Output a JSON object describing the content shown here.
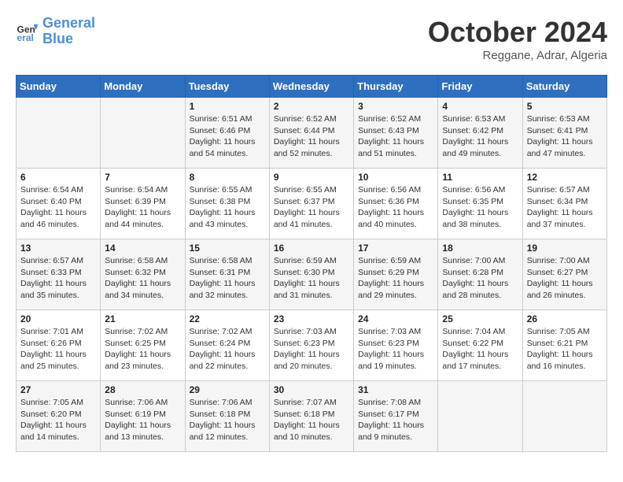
{
  "header": {
    "logo_line1": "General",
    "logo_line2": "Blue",
    "month": "October 2024",
    "location": "Reggane, Adrar, Algeria"
  },
  "weekdays": [
    "Sunday",
    "Monday",
    "Tuesday",
    "Wednesday",
    "Thursday",
    "Friday",
    "Saturday"
  ],
  "weeks": [
    [
      {
        "day": "",
        "sunrise": "",
        "sunset": "",
        "daylight": ""
      },
      {
        "day": "",
        "sunrise": "",
        "sunset": "",
        "daylight": ""
      },
      {
        "day": "1",
        "sunrise": "Sunrise: 6:51 AM",
        "sunset": "Sunset: 6:46 PM",
        "daylight": "Daylight: 11 hours and 54 minutes."
      },
      {
        "day": "2",
        "sunrise": "Sunrise: 6:52 AM",
        "sunset": "Sunset: 6:44 PM",
        "daylight": "Daylight: 11 hours and 52 minutes."
      },
      {
        "day": "3",
        "sunrise": "Sunrise: 6:52 AM",
        "sunset": "Sunset: 6:43 PM",
        "daylight": "Daylight: 11 hours and 51 minutes."
      },
      {
        "day": "4",
        "sunrise": "Sunrise: 6:53 AM",
        "sunset": "Sunset: 6:42 PM",
        "daylight": "Daylight: 11 hours and 49 minutes."
      },
      {
        "day": "5",
        "sunrise": "Sunrise: 6:53 AM",
        "sunset": "Sunset: 6:41 PM",
        "daylight": "Daylight: 11 hours and 47 minutes."
      }
    ],
    [
      {
        "day": "6",
        "sunrise": "Sunrise: 6:54 AM",
        "sunset": "Sunset: 6:40 PM",
        "daylight": "Daylight: 11 hours and 46 minutes."
      },
      {
        "day": "7",
        "sunrise": "Sunrise: 6:54 AM",
        "sunset": "Sunset: 6:39 PM",
        "daylight": "Daylight: 11 hours and 44 minutes."
      },
      {
        "day": "8",
        "sunrise": "Sunrise: 6:55 AM",
        "sunset": "Sunset: 6:38 PM",
        "daylight": "Daylight: 11 hours and 43 minutes."
      },
      {
        "day": "9",
        "sunrise": "Sunrise: 6:55 AM",
        "sunset": "Sunset: 6:37 PM",
        "daylight": "Daylight: 11 hours and 41 minutes."
      },
      {
        "day": "10",
        "sunrise": "Sunrise: 6:56 AM",
        "sunset": "Sunset: 6:36 PM",
        "daylight": "Daylight: 11 hours and 40 minutes."
      },
      {
        "day": "11",
        "sunrise": "Sunrise: 6:56 AM",
        "sunset": "Sunset: 6:35 PM",
        "daylight": "Daylight: 11 hours and 38 minutes."
      },
      {
        "day": "12",
        "sunrise": "Sunrise: 6:57 AM",
        "sunset": "Sunset: 6:34 PM",
        "daylight": "Daylight: 11 hours and 37 minutes."
      }
    ],
    [
      {
        "day": "13",
        "sunrise": "Sunrise: 6:57 AM",
        "sunset": "Sunset: 6:33 PM",
        "daylight": "Daylight: 11 hours and 35 minutes."
      },
      {
        "day": "14",
        "sunrise": "Sunrise: 6:58 AM",
        "sunset": "Sunset: 6:32 PM",
        "daylight": "Daylight: 11 hours and 34 minutes."
      },
      {
        "day": "15",
        "sunrise": "Sunrise: 6:58 AM",
        "sunset": "Sunset: 6:31 PM",
        "daylight": "Daylight: 11 hours and 32 minutes."
      },
      {
        "day": "16",
        "sunrise": "Sunrise: 6:59 AM",
        "sunset": "Sunset: 6:30 PM",
        "daylight": "Daylight: 11 hours and 31 minutes."
      },
      {
        "day": "17",
        "sunrise": "Sunrise: 6:59 AM",
        "sunset": "Sunset: 6:29 PM",
        "daylight": "Daylight: 11 hours and 29 minutes."
      },
      {
        "day": "18",
        "sunrise": "Sunrise: 7:00 AM",
        "sunset": "Sunset: 6:28 PM",
        "daylight": "Daylight: 11 hours and 28 minutes."
      },
      {
        "day": "19",
        "sunrise": "Sunrise: 7:00 AM",
        "sunset": "Sunset: 6:27 PM",
        "daylight": "Daylight: 11 hours and 26 minutes."
      }
    ],
    [
      {
        "day": "20",
        "sunrise": "Sunrise: 7:01 AM",
        "sunset": "Sunset: 6:26 PM",
        "daylight": "Daylight: 11 hours and 25 minutes."
      },
      {
        "day": "21",
        "sunrise": "Sunrise: 7:02 AM",
        "sunset": "Sunset: 6:25 PM",
        "daylight": "Daylight: 11 hours and 23 minutes."
      },
      {
        "day": "22",
        "sunrise": "Sunrise: 7:02 AM",
        "sunset": "Sunset: 6:24 PM",
        "daylight": "Daylight: 11 hours and 22 minutes."
      },
      {
        "day": "23",
        "sunrise": "Sunrise: 7:03 AM",
        "sunset": "Sunset: 6:23 PM",
        "daylight": "Daylight: 11 hours and 20 minutes."
      },
      {
        "day": "24",
        "sunrise": "Sunrise: 7:03 AM",
        "sunset": "Sunset: 6:23 PM",
        "daylight": "Daylight: 11 hours and 19 minutes."
      },
      {
        "day": "25",
        "sunrise": "Sunrise: 7:04 AM",
        "sunset": "Sunset: 6:22 PM",
        "daylight": "Daylight: 11 hours and 17 minutes."
      },
      {
        "day": "26",
        "sunrise": "Sunrise: 7:05 AM",
        "sunset": "Sunset: 6:21 PM",
        "daylight": "Daylight: 11 hours and 16 minutes."
      }
    ],
    [
      {
        "day": "27",
        "sunrise": "Sunrise: 7:05 AM",
        "sunset": "Sunset: 6:20 PM",
        "daylight": "Daylight: 11 hours and 14 minutes."
      },
      {
        "day": "28",
        "sunrise": "Sunrise: 7:06 AM",
        "sunset": "Sunset: 6:19 PM",
        "daylight": "Daylight: 11 hours and 13 minutes."
      },
      {
        "day": "29",
        "sunrise": "Sunrise: 7:06 AM",
        "sunset": "Sunset: 6:18 PM",
        "daylight": "Daylight: 11 hours and 12 minutes."
      },
      {
        "day": "30",
        "sunrise": "Sunrise: 7:07 AM",
        "sunset": "Sunset: 6:18 PM",
        "daylight": "Daylight: 11 hours and 10 minutes."
      },
      {
        "day": "31",
        "sunrise": "Sunrise: 7:08 AM",
        "sunset": "Sunset: 6:17 PM",
        "daylight": "Daylight: 11 hours and 9 minutes."
      },
      {
        "day": "",
        "sunrise": "",
        "sunset": "",
        "daylight": ""
      },
      {
        "day": "",
        "sunrise": "",
        "sunset": "",
        "daylight": ""
      }
    ]
  ]
}
